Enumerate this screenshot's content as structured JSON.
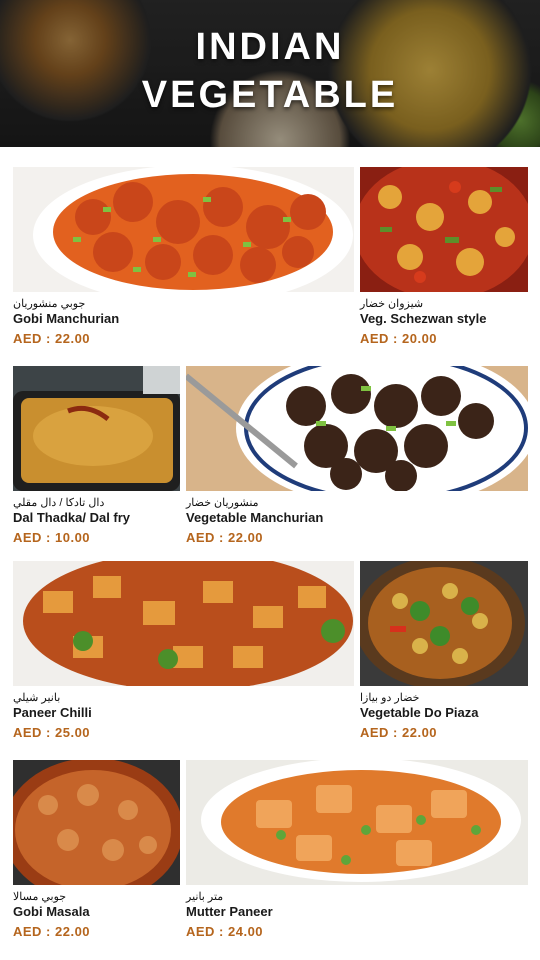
{
  "header": {
    "title_line1": "INDIAN",
    "title_line2": "VEGETABLE"
  },
  "items": [
    {
      "arabic": "جوبي منشوريان",
      "name": "Gobi Manchurian",
      "price": "AED : 22.00"
    },
    {
      "arabic": "شيزوان خضار",
      "name": "Veg. Schezwan style",
      "price": "AED : 20.00"
    },
    {
      "arabic": "دال تادكا / دال مقلي",
      "name": "Dal Thadka/ Dal fry",
      "price": "AED : 10.00"
    },
    {
      "arabic": "منشوريان خضار",
      "name": "Vegetable Manchurian",
      "price": "AED : 22.00"
    },
    {
      "arabic": "بانير شيلي",
      "name": "Paneer Chilli",
      "price": "AED : 25.00"
    },
    {
      "arabic": "خضار دو بيازا",
      "name": "Vegetable Do Piaza",
      "price": "AED : 22.00"
    },
    {
      "arabic": "جوبي مسالا",
      "name": "Gobi Masala",
      "price": "AED : 22.00"
    },
    {
      "arabic": "متر بانير",
      "name": "Mutter Paneer",
      "price": "AED : 24.00"
    }
  ]
}
